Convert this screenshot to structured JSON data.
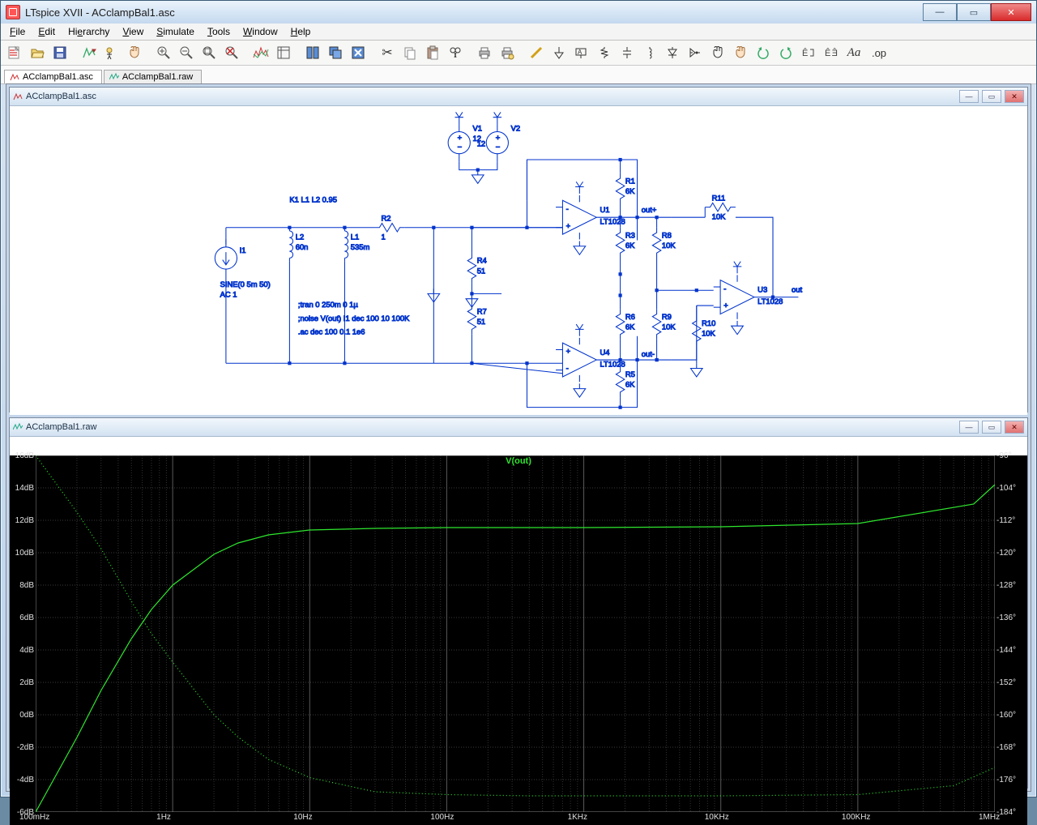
{
  "app": {
    "title": "LTspice XVII - ACclampBal1.asc"
  },
  "menu": {
    "items": [
      "File",
      "Edit",
      "Hierarchy",
      "View",
      "Simulate",
      "Tools",
      "Window",
      "Help"
    ]
  },
  "tabs": [
    {
      "label": "ACclampBal1.asc",
      "icon": "schematic"
    },
    {
      "label": "ACclampBal1.raw",
      "icon": "waveform"
    }
  ],
  "sub1": {
    "title": "ACclampBal1.asc"
  },
  "sub2": {
    "title": "ACclampBal1.raw"
  },
  "schem_text": {
    "kline": "K1 L1 L2 0.95",
    "I1": "I1",
    "SINE": "SINE(0 5m 50)",
    "AC": "AC 1",
    "L2": "L2",
    "L2v": "60n",
    "L1": "L1",
    "L1v": "535m",
    "dir1": ";tran 0 250m 0 1µ",
    "dir2": ";noise V(out) I1 dec 100 10 100K",
    "dir3": ".ac dec 100 0.1 1e6",
    "R2": "R2",
    "R2v": "1",
    "R4": "R4",
    "R4v": "51",
    "R7": "R7",
    "R7v": "51",
    "V1": "V1",
    "V1v": "12",
    "V2": "V2",
    "V2v": "12",
    "U1": "U1",
    "U1p": "LT1028",
    "R1": "R1",
    "R1v": "6K",
    "R3": "R3",
    "R3v": "6K",
    "R8": "R8",
    "R8v": "10K",
    "outp": "out+",
    "U4": "U4",
    "U4p": "LT1028",
    "R6": "R6",
    "R6v": "6K",
    "R5": "R5",
    "R5v": "6K",
    "R9": "R9",
    "R9v": "10K",
    "outm": "out-",
    "U3": "U3",
    "U3p": "LT1028",
    "R11": "R11",
    "R11v": "10K",
    "R10": "R10",
    "R10v": "10K",
    "out": "out"
  },
  "chart_data": {
    "type": "line",
    "title": "V(out)",
    "xlabel": "",
    "ylabel_left": "dB",
    "ylabel_right": "°",
    "x_scale": "log",
    "x_ticks": [
      "100mHz",
      "1Hz",
      "10Hz",
      "100Hz",
      "1KHz",
      "10KHz",
      "100KHz",
      "1MHz"
    ],
    "y_left_ticks": [
      16,
      14,
      12,
      10,
      8,
      6,
      4,
      2,
      0,
      -2,
      -4,
      -6
    ],
    "y_right_ticks": [
      -96,
      -104,
      -112,
      -120,
      -128,
      -136,
      -144,
      -152,
      -160,
      -168,
      -176,
      -184
    ],
    "ylim_left": [
      -6,
      16
    ],
    "ylim_right": [
      -184,
      -96
    ],
    "xlim": [
      0.1,
      1000000
    ],
    "series": [
      {
        "name": "magnitude_dB",
        "axis": "left",
        "style": "solid",
        "x": [
          0.1,
          0.2,
          0.3,
          0.5,
          0.7,
          1,
          2,
          3,
          5,
          10,
          30,
          100,
          1000,
          10000,
          100000,
          700000,
          1000000
        ],
        "y": [
          -6,
          -1.4,
          1.5,
          4.7,
          6.5,
          8.0,
          9.9,
          10.6,
          11.1,
          11.4,
          11.5,
          11.55,
          11.55,
          11.6,
          11.8,
          13.0,
          14.2
        ]
      },
      {
        "name": "phase_deg",
        "axis": "right",
        "style": "dotted",
        "x": [
          0.1,
          0.2,
          0.3,
          0.5,
          0.7,
          1,
          2,
          3,
          5,
          10,
          30,
          100,
          400,
          1000,
          10000,
          100000,
          500000,
          1000000
        ],
        "y": [
          -96,
          -110,
          -119,
          -132,
          -140,
          -147,
          -160,
          -165.5,
          -171,
          -175.5,
          -179,
          -179.7,
          -180,
          -180,
          -180,
          -179.7,
          -177.5,
          -173
        ]
      }
    ]
  },
  "op": ".op"
}
